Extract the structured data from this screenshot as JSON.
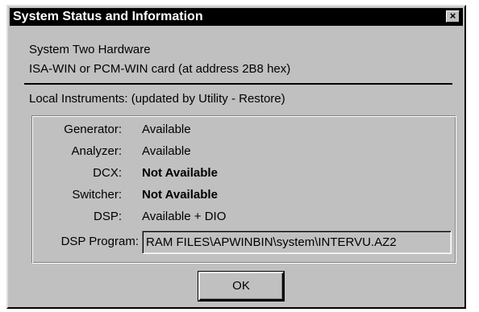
{
  "window": {
    "title": "System Status and Information",
    "close_glyph": "×"
  },
  "hardware": {
    "heading": "System Two Hardware",
    "card": "ISA-WIN or PCM-WIN card  (at address 2B8 hex)"
  },
  "local_instruments": {
    "heading": "Local Instruments: (updated by Utility - Restore)",
    "rows": [
      {
        "label": "Generator:",
        "value": "Available"
      },
      {
        "label": "Analyzer:",
        "value": "Available"
      },
      {
        "label": "DCX:",
        "value": "Not Available"
      },
      {
        "label": "Switcher:",
        "value": "Not Available"
      },
      {
        "label": "DSP:",
        "value": "Available + DIO"
      }
    ],
    "dsp_program": {
      "label": "DSP Program:",
      "value": "RAM FILES\\APWINBIN\\system\\INTERVU.AZ2"
    }
  },
  "buttons": {
    "ok_label": "OK"
  },
  "icons": {
    "close": "close-icon"
  },
  "colors": {
    "titlebar_bg": "#000000",
    "titlebar_text": "#ffffff",
    "dialog_bg": "#c0c0c0"
  }
}
